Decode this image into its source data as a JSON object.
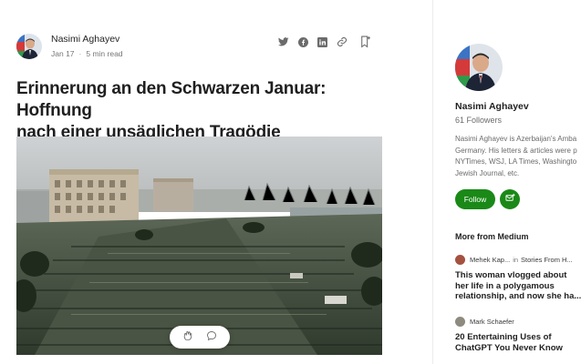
{
  "author": {
    "name": "Nasimi Aghayev",
    "date": "Jan 17",
    "read_time": "5 min read"
  },
  "article": {
    "title_line1": "Erinnerung an den Schwarzen Januar: Hoffnung",
    "title_line2": "nach einer unsäglichen Tragödie"
  },
  "share": {
    "icons": [
      "twitter-icon",
      "facebook-icon",
      "linkedin-icon",
      "link-icon",
      "bookmark-icon"
    ]
  },
  "floating_bar": {
    "icons": [
      "clap-icon",
      "comment-icon"
    ]
  },
  "sidebar": {
    "name": "Nasimi Aghayev",
    "followers": "61 Followers",
    "bio_lines": [
      "Nasimi Aghayev is Azerbaijan's Amba",
      "Germany. His letters & articles were p",
      "NYTimes, WSJ, LA Times, Washingto",
      "Jewish Journal, etc."
    ],
    "follow_label": "Follow",
    "more_heading": "More from Medium"
  },
  "recommendations": [
    {
      "author": "Mehek Kap...",
      "in_label": "in",
      "publication": "Stories From H...",
      "title_lines": [
        "This woman vlogged about",
        "her life in a polygamous",
        "relationship, and now she ha..."
      ]
    },
    {
      "author": "Mark Schaefer",
      "title_lines": [
        "20 Entertaining Uses of",
        "ChatGPT You Never Know"
      ]
    }
  ],
  "colors": {
    "accent_green": "#1a8917",
    "text_primary": "#242424",
    "text_muted": "#757575"
  }
}
